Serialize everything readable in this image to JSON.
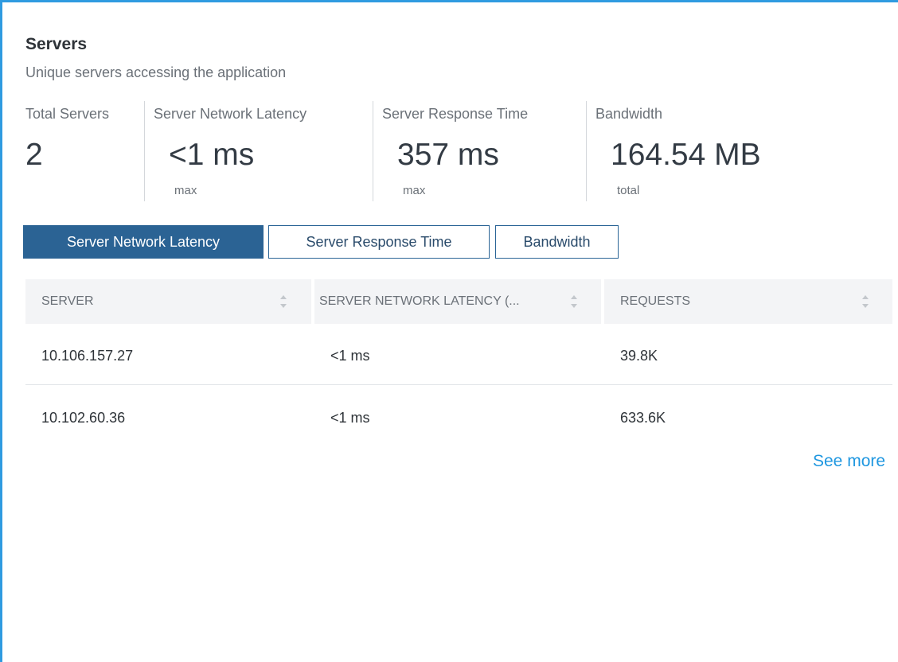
{
  "panel": {
    "title": "Servers",
    "subtitle": "Unique servers accessing the application",
    "accent_color": "#2f9be0"
  },
  "metrics": [
    {
      "label": "Total Servers",
      "value": "2",
      "sub": ""
    },
    {
      "label": "Server Network Latency",
      "value": "<1 ms",
      "sub": "max"
    },
    {
      "label": "Server Response Time",
      "value": "357 ms",
      "sub": "max"
    },
    {
      "label": "Bandwidth",
      "value": "164.54 MB",
      "sub": "total"
    }
  ],
  "tabs": [
    {
      "label": "Server Network Latency",
      "active": true
    },
    {
      "label": "Server Response Time",
      "active": false
    },
    {
      "label": "Bandwidth",
      "active": false
    }
  ],
  "table": {
    "headers": [
      "SERVER",
      "SERVER NETWORK LATENCY (...",
      "REQUESTS"
    ],
    "sort_icon": "sort-up-down-icon",
    "rows": [
      [
        "10.106.157.27",
        "<1 ms",
        "39.8K"
      ],
      [
        "10.102.60.36",
        "<1 ms",
        "633.6K"
      ]
    ]
  },
  "see_more_label": "See more",
  "colors": {
    "tab_active_bg": "#2b6394",
    "link": "#1f97e0",
    "header_bg": "#f3f4f6"
  }
}
